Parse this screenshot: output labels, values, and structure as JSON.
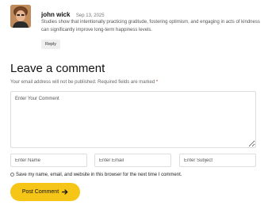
{
  "comment": {
    "author": "john wick",
    "date": "Sep 13, 2025",
    "text": "Studies show that intentionally practicing gratitude, fostering optimism, and engaging in acts of kindness can significantly improve long-term happiness levels.",
    "reply_label": "Reply"
  },
  "form": {
    "title": "Leave a comment",
    "notice": "Your email address will not be published. Required fields are marked",
    "required_mark": "*",
    "comment_placeholder": "Enter Your Comment",
    "name_placeholder": "Enter Name",
    "email_placeholder": "Enter Email",
    "subject_placeholder": "Enter Subject",
    "save_label": "Save my name, email, and website in this browser for the next time I comment.",
    "submit_label": "Post Comment"
  },
  "colors": {
    "accent": "#f5c518",
    "required": "#c0392b"
  },
  "icons": {
    "submit": "arrow-right-icon",
    "avatar": "user-avatar"
  }
}
